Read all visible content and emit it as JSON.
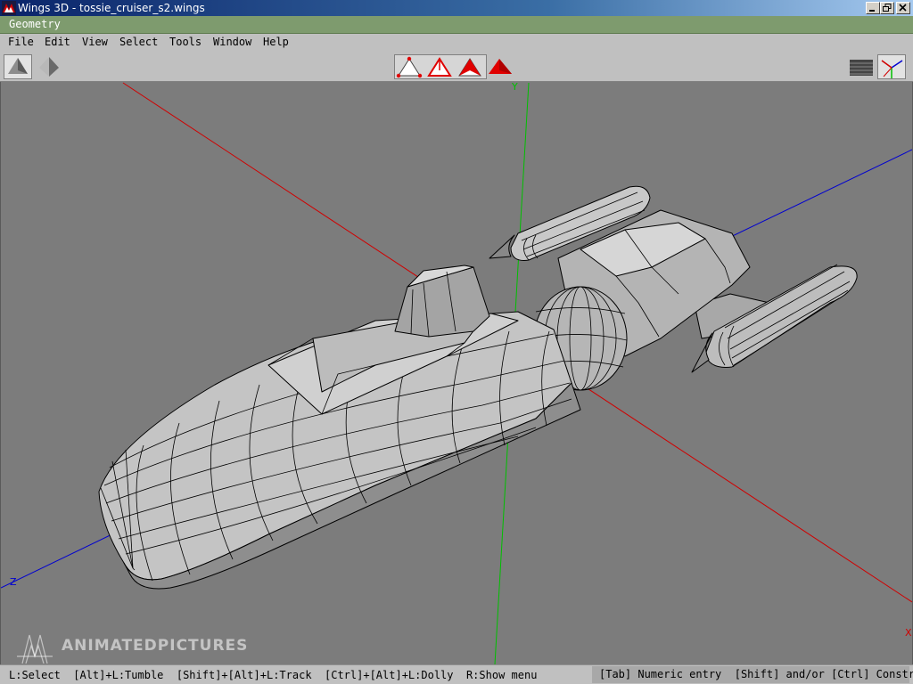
{
  "window": {
    "title": "Wings 3D - tossie_cruiser_s2.wings",
    "controls": [
      "minimize-icon",
      "maximize-icon",
      "close-icon"
    ]
  },
  "geometry_header": {
    "label": "Geometry"
  },
  "menubar": {
    "items": [
      "File",
      "Edit",
      "View",
      "Select",
      "Tools",
      "Window",
      "Help"
    ]
  },
  "toolbar": {
    "view_buttons": [
      "smooth-shaded-icon",
      "flat-shaded-icon"
    ],
    "selection_modes": [
      "vertex-select-icon",
      "edge-select-icon",
      "face-select-icon",
      "body-select-icon"
    ],
    "right_buttons": [
      "groundplane-icon",
      "axes-icon"
    ],
    "accent_color": "#e00000"
  },
  "viewport": {
    "axis_labels": {
      "x": "X",
      "y": "Y",
      "z": "Z"
    },
    "axis_colors": {
      "x": "#d00000",
      "y": "#00c000",
      "z": "#0000d0"
    },
    "background": "#7c7c7c",
    "watermark": "ANIMATEDPICTURES"
  },
  "statusbar": {
    "left": "L:Select  [Alt]+L:Tumble  [Shift]+[Alt]+L:Track  [Ctrl]+[Alt]+L:Dolly  R:Show menu",
    "right": "[Tab] Numeric entry  [Shift] and/or [Ctrl] Constrain"
  }
}
